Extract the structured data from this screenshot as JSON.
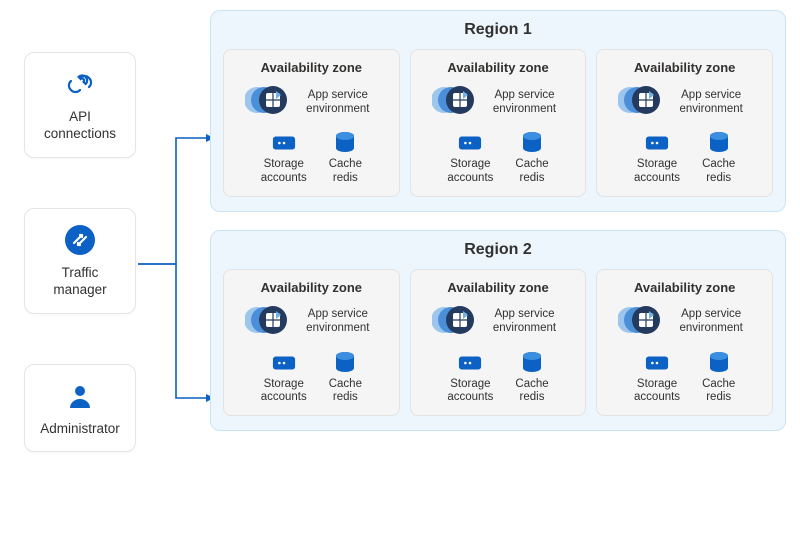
{
  "colors": {
    "azure_blue": "#0b61c4",
    "azure_dark": "#243a5e",
    "region_bg": "#eef6fd"
  },
  "left": {
    "api": {
      "label": "API\nconnections",
      "icon": "link-icon"
    },
    "tm": {
      "label": "Traffic\nmanager",
      "icon": "traffic-manager-icon"
    },
    "admin": {
      "label": "Administrator",
      "icon": "person-icon"
    }
  },
  "regions": [
    {
      "title": "Region 1",
      "zones": [
        {
          "title": "Availability zone",
          "ase": "App service\nenvironment",
          "services": [
            {
              "label": "Storage\naccounts",
              "icon": "storage"
            },
            {
              "label": "Cache\nredis",
              "icon": "redis"
            }
          ]
        },
        {
          "title": "Availability zone",
          "ase": "App service\nenvironment",
          "services": [
            {
              "label": "Storage\naccounts",
              "icon": "storage"
            },
            {
              "label": "Cache\nredis",
              "icon": "redis"
            }
          ]
        },
        {
          "title": "Availability zone",
          "ase": "App service\nenvironment",
          "services": [
            {
              "label": "Storage\naccounts",
              "icon": "storage"
            },
            {
              "label": "Cache\nredis",
              "icon": "redis"
            }
          ]
        }
      ]
    },
    {
      "title": "Region 2",
      "zones": [
        {
          "title": "Availability zone",
          "ase": "App service\nenvironment",
          "services": [
            {
              "label": "Storage\naccounts",
              "icon": "storage"
            },
            {
              "label": "Cache\nredis",
              "icon": "redis"
            }
          ]
        },
        {
          "title": "Availability zone",
          "ase": "App service\nenvironment",
          "services": [
            {
              "label": "Storage\naccounts",
              "icon": "storage"
            },
            {
              "label": "Cache\nredis",
              "icon": "redis"
            }
          ]
        },
        {
          "title": "Availability zone",
          "ase": "App service\nenvironment",
          "services": [
            {
              "label": "Storage\naccounts",
              "icon": "storage"
            },
            {
              "label": "Cache\nredis",
              "icon": "redis"
            }
          ]
        }
      ]
    }
  ]
}
